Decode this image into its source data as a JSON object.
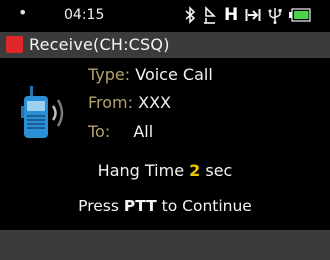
{
  "status_bar": {
    "indicator": "•",
    "time": "04:15",
    "icons": [
      "bluetooth-icon",
      "gps-icon",
      "h-indicator-icon",
      "key-icon",
      "usb-icon",
      "battery-icon"
    ],
    "h_label": "H"
  },
  "title_bar": {
    "title": "Receive(CH:CSQ)",
    "indicator_color": "#e0282a"
  },
  "call_info": {
    "type_label": "Type:",
    "type_value": "Voice Call",
    "from_label": "From:",
    "from_value": "XXX",
    "to_label": "To:",
    "to_value": "All"
  },
  "hang_time": {
    "prefix": "Hang Time ",
    "value": "2",
    "suffix": " sec"
  },
  "instruction": {
    "prefix": "Press ",
    "key": "PTT",
    "suffix": " to Continue"
  },
  "colors": {
    "label": "#b3a36a",
    "accent_number": "#f0c800",
    "battery": "#4cd24c",
    "radio_body": "#2a8fd6"
  }
}
